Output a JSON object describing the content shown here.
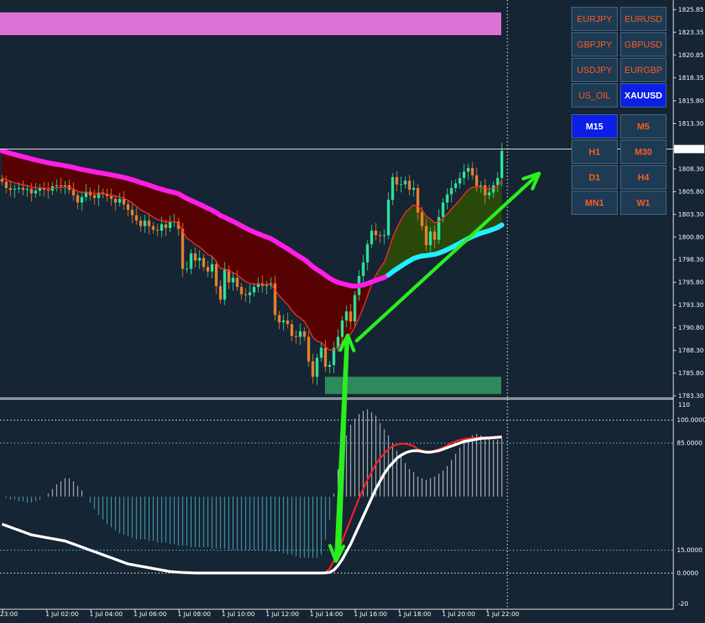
{
  "symbols": [
    {
      "label": "EURJPY",
      "active": false
    },
    {
      "label": "EURUSD",
      "active": false
    },
    {
      "label": "GBPJPY",
      "active": false
    },
    {
      "label": "GBPUSD",
      "active": false
    },
    {
      "label": "USDJPY",
      "active": false
    },
    {
      "label": "EURGBP",
      "active": false
    },
    {
      "label": "US_OIL",
      "active": false
    },
    {
      "label": "XAUUSD",
      "active": true
    }
  ],
  "timeframes": [
    {
      "label": "M15",
      "active": true
    },
    {
      "label": "M5",
      "active": false
    },
    {
      "label": "H1",
      "active": false
    },
    {
      "label": "M30",
      "active": false
    },
    {
      "label": "D1",
      "active": false
    },
    {
      "label": "H4",
      "active": false
    },
    {
      "label": "MN1",
      "active": false
    },
    {
      "label": "W1",
      "active": false
    }
  ],
  "colors": {
    "background": "#162534",
    "bull_candle": "#2ee39a",
    "bear_candle": "#e8812f",
    "slow_ma": "#ff1ee8",
    "slow_ma_bull": "#1ef0ff",
    "fast_ma": "#ff2a2a",
    "bear_fill": "#5a0000",
    "bull_fill": "#2c4a0a",
    "supply_zone": "#dc72d6",
    "demand_zone": "#2d8a5c",
    "arrow": "#2aee1e",
    "osc_histogram": "#5ad2e6",
    "osc_signal": "#ff2020",
    "osc_main": "#ffffff"
  },
  "chart_data": [
    {
      "type": "candlestick",
      "symbol": "XAUUSD",
      "timeframe": "M15",
      "ylim": [
        1783.3,
        1825.85
      ],
      "y_ticks": [
        "1825.85",
        "1823.35",
        "1820.85",
        "1818.35",
        "1815.80",
        "1813.30",
        "1808.30",
        "1805.80",
        "1803.30",
        "1800.80",
        "1798.30",
        "1795.80",
        "1793.30",
        "1790.80",
        "1788.30",
        "1785.80",
        "1783.30"
      ],
      "current_price": "1810.49",
      "x_ticks": [
        "23:00",
        "1 Jul 02:00",
        "1 Jul 04:00",
        "1 Jul 06:00",
        "1 Jul 08:00",
        "1 Jul 10:00",
        "1 Jul 12:00",
        "1 Jul 14:00",
        "1 Jul 16:00",
        "1 Jul 18:00",
        "1 Jul 20:00",
        "1 Jul 22:00"
      ],
      "closes": [
        1806.9,
        1806.2,
        1806.0,
        1806.1,
        1806.2,
        1806.0,
        1806.1,
        1805.6,
        1805.9,
        1806.2,
        1806.0,
        1805.9,
        1806.4,
        1806.5,
        1806.4,
        1806.5,
        1806.0,
        1805.4,
        1804.6,
        1805.2,
        1805.8,
        1805.4,
        1805.1,
        1805.7,
        1805.5,
        1805.3,
        1805.0,
        1804.6,
        1805.0,
        1804.4,
        1803.8,
        1803.2,
        1802.6,
        1802.0,
        1802.6,
        1802.0,
        1801.6,
        1801.5,
        1802.2,
        1801.8,
        1802.5,
        1802.5,
        1801.7,
        1797.3,
        1797.3,
        1799.0,
        1798.2,
        1798.5,
        1797.5,
        1797.0,
        1797.8,
        1795.4,
        1793.9,
        1797.2,
        1795.8,
        1796.3,
        1795.3,
        1794.5,
        1794.4,
        1794.7,
        1795.3,
        1795.7,
        1795.4,
        1795.5,
        1795.7,
        1792.2,
        1791.4,
        1791.6,
        1791.2,
        1789.9,
        1789.8,
        1790.4,
        1789.8,
        1787.1,
        1785.4,
        1787.5,
        1788.6,
        1786.5,
        1786.7,
        1788.6,
        1789.8,
        1791.6,
        1792.6,
        1791.5,
        1794.4,
        1796.5,
        1798.0,
        1800.0,
        1801.5,
        1801.0,
        1800.9,
        1801.0,
        1804.9,
        1807.4,
        1806.6,
        1806.6,
        1807.0,
        1806.0,
        1806.2,
        1803.5,
        1802.0,
        1799.9,
        1801.4,
        1800.5,
        1803.0,
        1804.6,
        1805.5,
        1806.2,
        1806.7,
        1807.3,
        1808.0,
        1808.4,
        1807.6,
        1806.4,
        1806.5,
        1805.4,
        1805.7,
        1806.5,
        1807.3,
        1810.3
      ]
    },
    {
      "type": "line",
      "name": "oscillator",
      "ylim": [
        -20,
        110
      ],
      "levels": [
        "100.0000",
        "85.0000",
        "15.0000",
        "0.0000"
      ],
      "y_ticks": [
        "110",
        "-20"
      ],
      "main_line": [
        32,
        31,
        30,
        29,
        28,
        27,
        26,
        25,
        24.5,
        24,
        23.5,
        23,
        22.5,
        22,
        21.5,
        21,
        20,
        19,
        18,
        17,
        16,
        15,
        14,
        13,
        12,
        11,
        10,
        9,
        8,
        7,
        6,
        5.5,
        5,
        4.5,
        4,
        3.5,
        3,
        2.5,
        2,
        1.5,
        1,
        0.8,
        0.6,
        0.4,
        0.3,
        0.2,
        0.1,
        0.1,
        0.1,
        0.1,
        0.1,
        0.1,
        0.1,
        0.1,
        0.1,
        0.1,
        0.1,
        0.1,
        0.1,
        0.1,
        0.1,
        0.1,
        0.1,
        0.1,
        0.1,
        0.1,
        0.1,
        0.1,
        0.1,
        0.1,
        0.1,
        0.1,
        0.1,
        0.1,
        0.1,
        0.1,
        0.1,
        0.2,
        0.5,
        2,
        5,
        9,
        14,
        19,
        25,
        31,
        37,
        43,
        49,
        55,
        60,
        65,
        69,
        72,
        75,
        77,
        78.5,
        79.5,
        80,
        80,
        79.5,
        79,
        79,
        79.5,
        80,
        81,
        82,
        83,
        84,
        85,
        86,
        86.5,
        87,
        87.5,
        88,
        88.2,
        88.3,
        88.5,
        88.7,
        89
      ],
      "signal_line": [
        32,
        31,
        30,
        29,
        28,
        27,
        26,
        25,
        24.5,
        24,
        23.5,
        23,
        22.5,
        22,
        21.5,
        21,
        20,
        19,
        18,
        17,
        16,
        15,
        14,
        13,
        12,
        11,
        10,
        9,
        8,
        7,
        6,
        5.5,
        5,
        4.5,
        4,
        3.5,
        3,
        2.5,
        2,
        1.5,
        1,
        0.8,
        0.6,
        0.4,
        0.3,
        0.2,
        0.1,
        0.1,
        0.1,
        0.1,
        0.1,
        0.1,
        0.1,
        0.1,
        0.1,
        0.1,
        0.1,
        0.1,
        0.1,
        0.1,
        0.1,
        0.1,
        0.1,
        0.1,
        0.1,
        0.1,
        0.1,
        0.1,
        0.1,
        0.1,
        0.1,
        0.1,
        0.1,
        0.1,
        0.1,
        0.1,
        0.1,
        0.5,
        3,
        8,
        14,
        21,
        28,
        35,
        42,
        49,
        55,
        61,
        66,
        71,
        75,
        78,
        81,
        83,
        84,
        84.5,
        84.5,
        84,
        83,
        81,
        80,
        79.5,
        79.5,
        80,
        81,
        82,
        83.5,
        85,
        86,
        87,
        87.5,
        88,
        88.3,
        88.5,
        88.6,
        88.7,
        88.8,
        89,
        89.2,
        89.5
      ],
      "histogram": [
        50,
        49,
        48,
        48,
        47,
        47,
        46,
        46,
        47,
        48,
        50,
        52,
        55,
        58,
        60,
        62,
        62,
        60,
        57,
        54,
        50,
        46,
        42,
        38,
        35,
        32,
        30,
        28,
        26,
        25,
        24,
        23,
        22,
        22,
        22,
        21,
        21,
        20,
        20,
        20,
        19,
        19,
        18,
        18,
        18,
        17,
        17,
        17,
        17,
        17,
        16,
        16,
        16,
        16,
        15,
        15,
        15,
        15,
        15,
        15,
        15,
        15,
        15,
        15,
        14,
        14,
        14,
        13,
        12,
        12,
        11,
        10,
        10,
        10,
        10,
        10,
        12,
        22,
        35,
        52,
        68,
        80,
        90,
        97,
        101,
        104,
        106,
        107,
        105,
        103,
        98,
        94,
        90,
        85,
        80,
        76,
        72,
        68,
        66,
        63,
        62,
        61,
        62,
        63,
        65,
        67,
        70,
        74,
        78,
        82,
        86,
        88,
        90,
        91,
        90,
        89,
        88,
        87,
        87,
        88
      ]
    }
  ]
}
